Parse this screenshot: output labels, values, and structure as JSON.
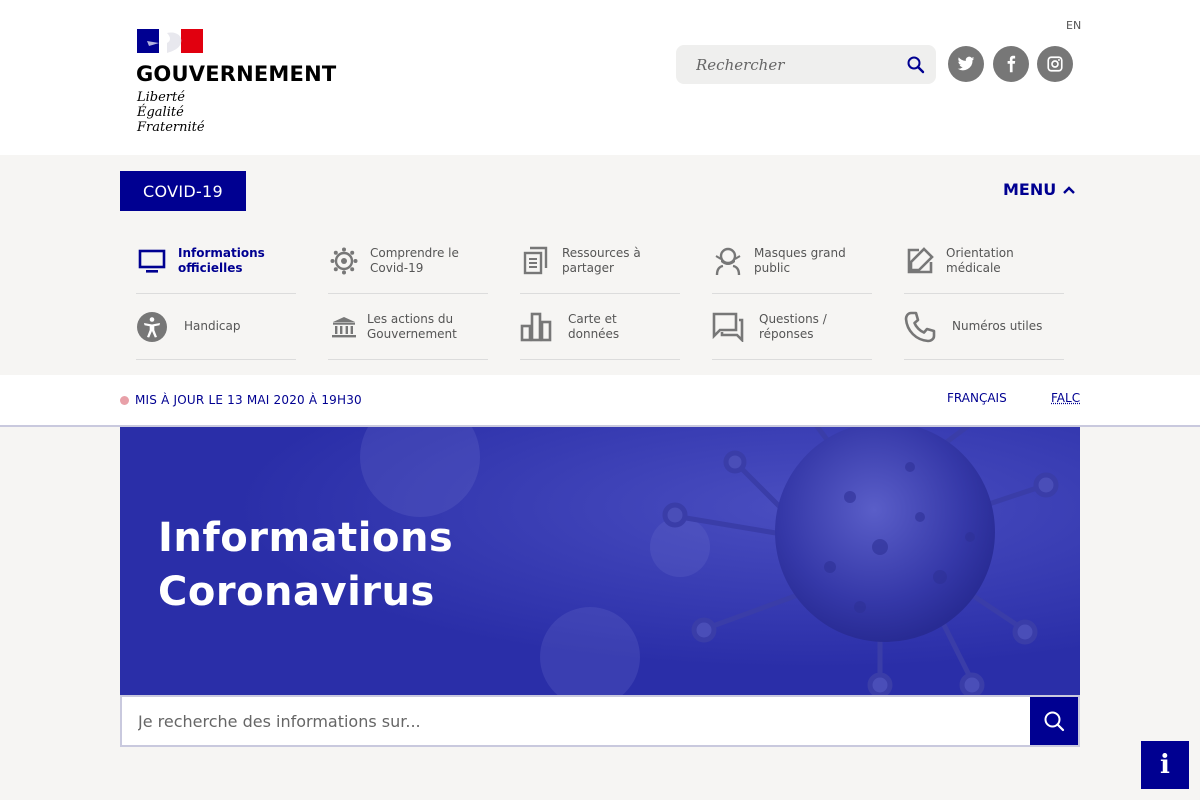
{
  "header": {
    "logo_title": "GOUVERNEMENT",
    "motto": [
      "Liberté",
      "Égalité",
      "Fraternité"
    ],
    "lang_switch": "EN",
    "search_placeholder": "Rechercher",
    "social": [
      "twitter-icon",
      "facebook-icon",
      "instagram-icon"
    ]
  },
  "nav": {
    "covid_label": "COVID-19",
    "menu_label": "MENU",
    "items": [
      {
        "label": "Informations officielles",
        "icon": "monitor-icon",
        "active": true
      },
      {
        "label": "Comprendre le Covid-19",
        "icon": "virus-icon",
        "active": false
      },
      {
        "label": "Ressources à partager",
        "icon": "documents-icon",
        "active": false
      },
      {
        "label": "Masques grand public",
        "icon": "mask-icon",
        "active": false
      },
      {
        "label": "Orientation médicale",
        "icon": "edit-note-icon",
        "active": false
      },
      {
        "label": "Handicap",
        "icon": "accessibility-icon",
        "active": false
      },
      {
        "label": "Les actions du Gouvernement",
        "icon": "government-building-icon",
        "active": false
      },
      {
        "label": "Carte et données",
        "icon": "bar-chart-icon",
        "active": false
      },
      {
        "label": "Questions / réponses",
        "icon": "chat-bubbles-icon",
        "active": false
      },
      {
        "label": "Numéros utiles",
        "icon": "phone-icon",
        "active": false
      }
    ]
  },
  "update_bar": {
    "text": "MIS À JOUR LE 13 MAI 2020 À 19H30",
    "lang_fr": "FRANÇAIS",
    "lang_falc": "FALC"
  },
  "hero": {
    "title_line1": "Informations",
    "title_line2": "Coronavirus",
    "search_placeholder": "Je recherche des informations sur..."
  },
  "floating_info": "i",
  "colors": {
    "primary": "#000091",
    "hero_bg": "#2a2ea8",
    "page_bg": "#f6f5f3",
    "flag_blue": "#000091",
    "flag_red": "#e1000f"
  }
}
